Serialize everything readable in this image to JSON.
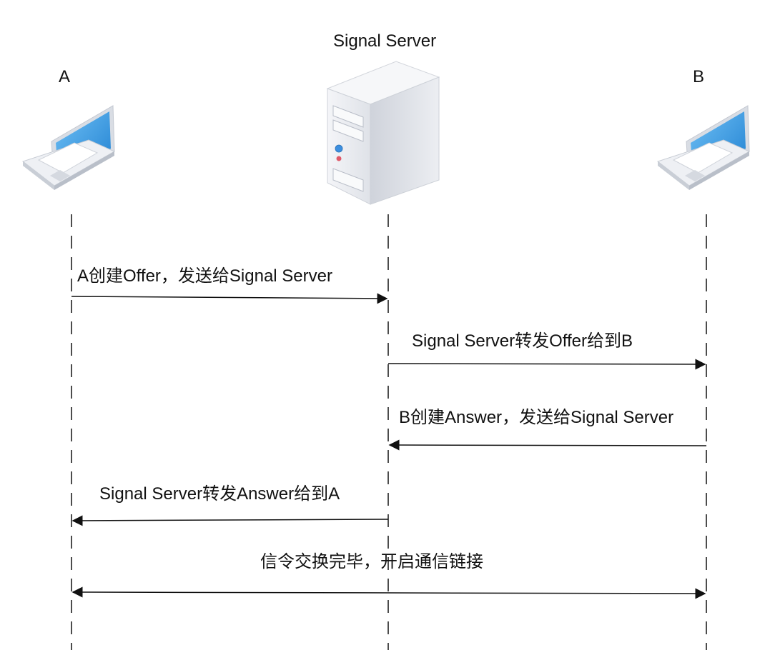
{
  "diagram": {
    "actors": {
      "a": {
        "label": "A",
        "icon": "laptop-icon"
      },
      "server": {
        "label": "Signal Server",
        "icon": "server-icon"
      },
      "b": {
        "label": "B",
        "icon": "laptop-icon"
      }
    },
    "messages": [
      {
        "text": "A创建Offer，发送给Signal Server",
        "from": "A",
        "to": "Signal Server"
      },
      {
        "text": "Signal Server转发Offer给到B",
        "from": "Signal Server",
        "to": "B"
      },
      {
        "text": "B创建Answer，发送给Signal Server",
        "from": "B",
        "to": "Signal Server"
      },
      {
        "text": "Signal Server转发Answer给到A",
        "from": "Signal Server",
        "to": "A"
      },
      {
        "text": "信令交换完毕，开启通信链接",
        "from": "A",
        "to": "B",
        "bidirectional": true
      }
    ],
    "colors": {
      "line": "#111111",
      "laptop_screen": "#3a9de8",
      "laptop_body": "#e6e9ee",
      "server_body": "#e8eaef"
    }
  }
}
